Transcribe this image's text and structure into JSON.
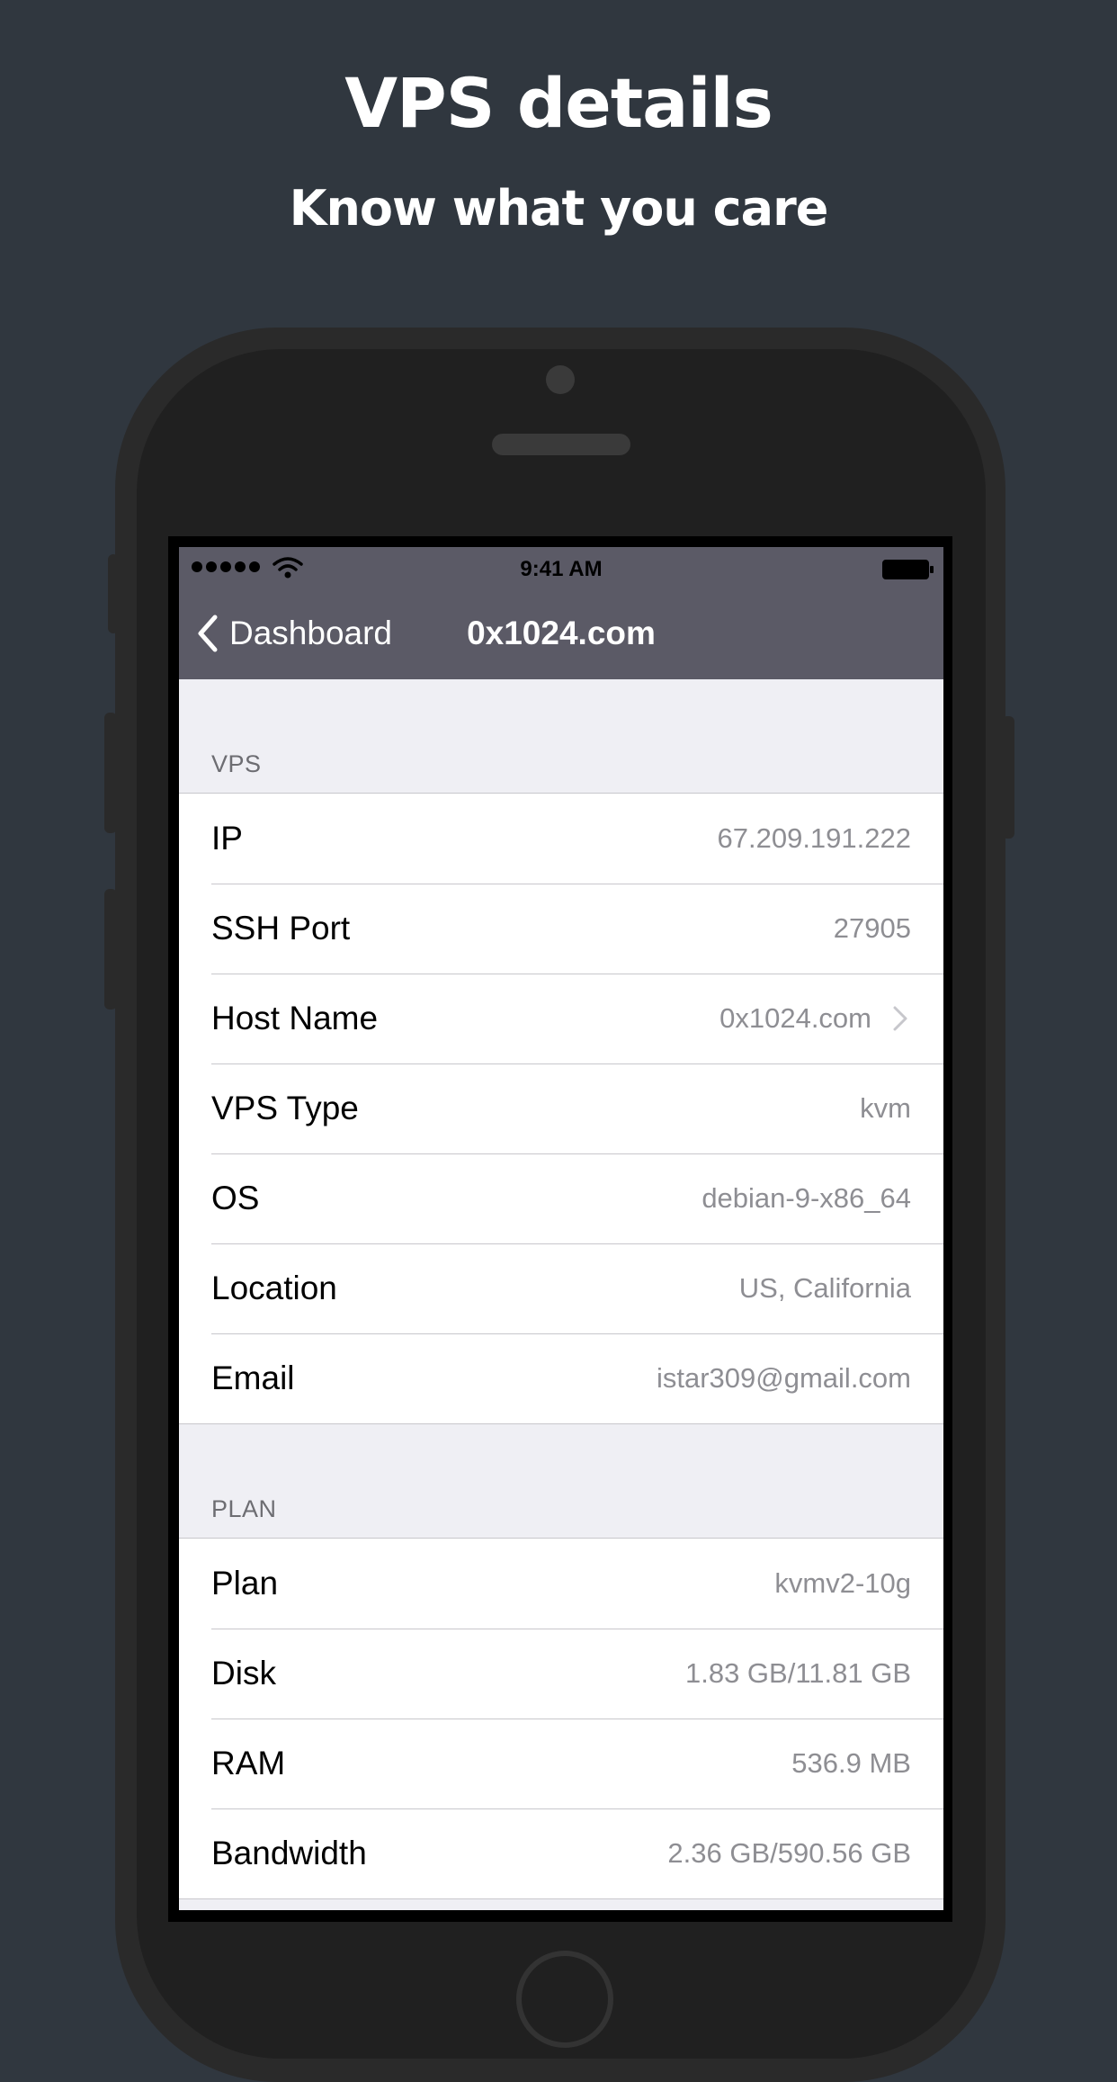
{
  "promo": {
    "title": "VPS details",
    "subtitle": "Know what you care"
  },
  "status_bar": {
    "time": "9:41 AM",
    "signal_icon": "signal-dots-icon",
    "wifi_icon": "wifi-icon",
    "battery_icon": "battery-icon"
  },
  "nav": {
    "back_label": "Dashboard",
    "title": "0x1024.com"
  },
  "sections": {
    "vps": {
      "header": "VPS",
      "rows": [
        {
          "label": "IP",
          "value": "67.209.191.222"
        },
        {
          "label": "SSH Port",
          "value": "27905"
        },
        {
          "label": "Host Name",
          "value": "0x1024.com"
        },
        {
          "label": "VPS Type",
          "value": "kvm"
        },
        {
          "label": "OS",
          "value": "debian-9-x86_64"
        },
        {
          "label": "Location",
          "value": "US, California"
        },
        {
          "label": "Email",
          "value": "istar309@gmail.com"
        }
      ]
    },
    "plan": {
      "header": "PLAN",
      "rows": [
        {
          "label": "Plan",
          "value": "kvmv2-10g"
        },
        {
          "label": "Disk",
          "value": "1.83 GB/11.81 GB"
        },
        {
          "label": "RAM",
          "value": "536.9 MB"
        },
        {
          "label": "Bandwidth",
          "value": "2.36 GB/590.56 GB"
        }
      ]
    }
  },
  "colors": {
    "background": "#30373f",
    "navbar": "#5b5a66",
    "table_background": "#efeff4",
    "value_text": "#8e8e93"
  }
}
